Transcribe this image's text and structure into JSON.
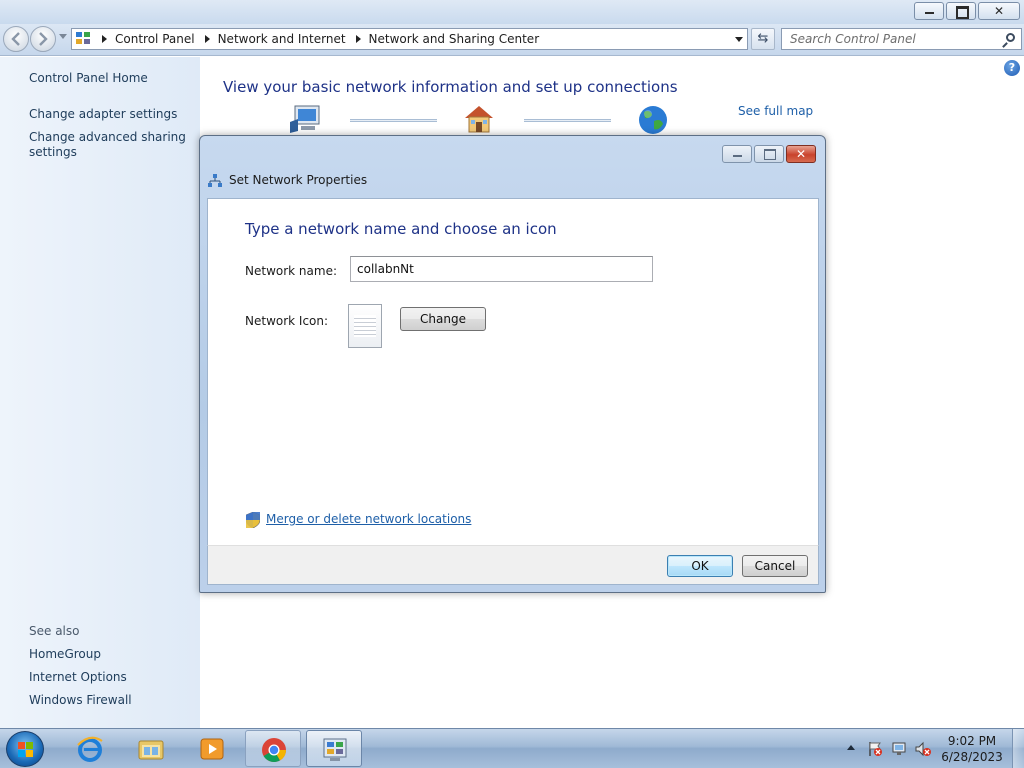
{
  "window": {
    "minimize_label": "",
    "maximize_label": "",
    "close_label": "✕"
  },
  "address_bar": {
    "breadcrumbs": [
      "Control Panel",
      "Network and Internet",
      "Network and Sharing Center"
    ]
  },
  "search": {
    "placeholder": "Search Control Panel"
  },
  "sidebar": {
    "home": "Control Panel Home",
    "links": [
      "Change adapter settings",
      "Change advanced sharing",
      "settings"
    ],
    "see_also_heading": "See also",
    "see_also": [
      "HomeGroup",
      "Internet Options",
      "Windows Firewall"
    ]
  },
  "main": {
    "title": "View your basic network information and set up connections",
    "see_full_map": "See full map",
    "help_glyph": "?"
  },
  "dialog": {
    "title": "Set Network Properties",
    "heading": "Type a network name and choose an icon",
    "network_name_label": "Network name:",
    "network_name_value": "collabnNt",
    "network_icon_label": "Network Icon:",
    "change_button": "Change",
    "merge_link": "Merge or delete network locations",
    "ok_button": "OK",
    "cancel_button": "Cancel",
    "close_glyph": "✕"
  },
  "taskbar": {
    "pinned": [
      "internet-explorer",
      "windows-explorer",
      "media-player",
      "google-chrome",
      "control-panel"
    ],
    "time": "9:02 PM",
    "date": "6/28/2023"
  },
  "colors": {
    "title_blue": "#1e3287",
    "link_blue": "#1e5fa8",
    "sidebar_bg": "#e5eef9",
    "close_red": "#c9432c"
  }
}
